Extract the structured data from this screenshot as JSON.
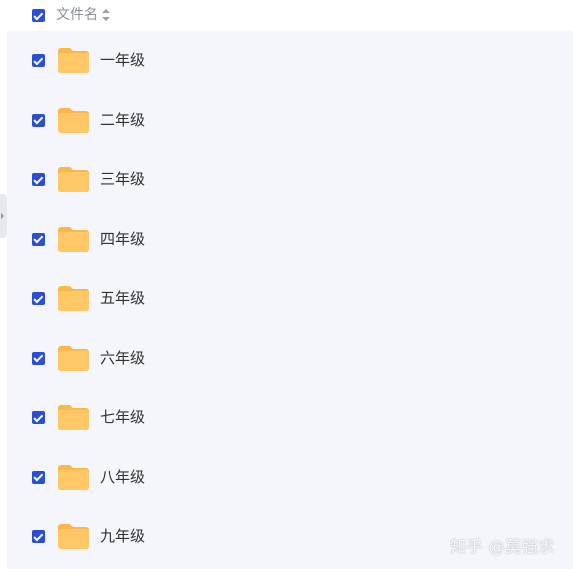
{
  "header": {
    "select_all_checked": true,
    "column_label": "文件名",
    "sort_icon": "sort-toggle-icon"
  },
  "files": [
    {
      "name": "一年级",
      "checked": true,
      "icon": "folder-icon"
    },
    {
      "name": "二年级",
      "checked": true,
      "icon": "folder-icon"
    },
    {
      "name": "三年级",
      "checked": true,
      "icon": "folder-icon"
    },
    {
      "name": "四年级",
      "checked": true,
      "icon": "folder-icon"
    },
    {
      "name": "五年级",
      "checked": true,
      "icon": "folder-icon"
    },
    {
      "name": "六年级",
      "checked": true,
      "icon": "folder-icon"
    },
    {
      "name": "七年级",
      "checked": true,
      "icon": "folder-icon"
    },
    {
      "name": "八年级",
      "checked": true,
      "icon": "folder-icon"
    },
    {
      "name": "九年级",
      "checked": true,
      "icon": "folder-icon"
    }
  ],
  "watermark": "知乎 @莫强求",
  "colors": {
    "checkbox": "#2a4fd6",
    "list_background": "#f5f6fb",
    "folder": "#ffc766",
    "folder_tab": "#f9b94a"
  }
}
